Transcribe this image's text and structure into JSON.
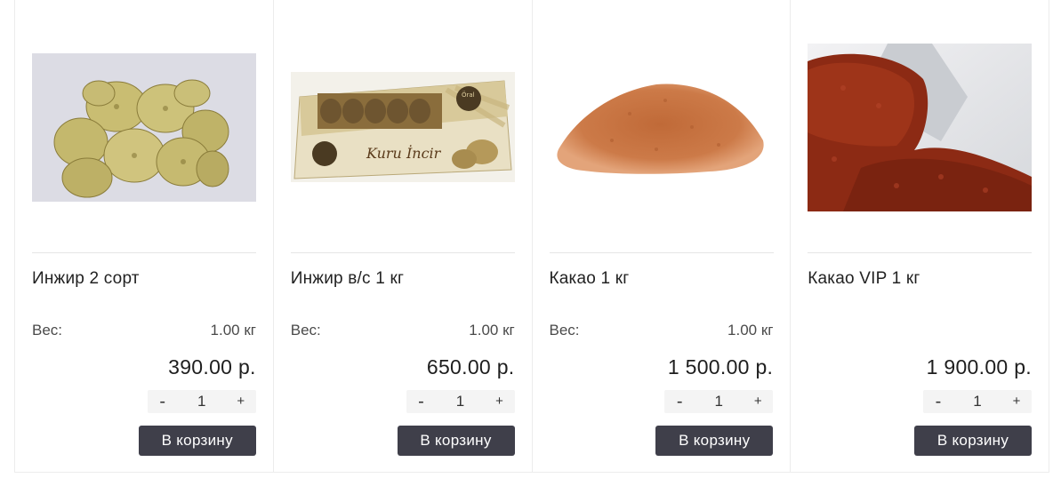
{
  "products": [
    {
      "title": "Инжир 2 сорт",
      "weight_label": "Вес:",
      "weight_value": "1.00 кг",
      "price": "390.00 р.",
      "qty_minus": "-",
      "qty_value": "1",
      "qty_plus": "+",
      "cart_label": "В корзину",
      "image": "dried-figs-photo"
    },
    {
      "title": "Инжир в/с 1 кг",
      "weight_label": "Вес:",
      "weight_value": "1.00 кг",
      "price": "650.00 р.",
      "qty_minus": "-",
      "qty_value": "1",
      "qty_plus": "+",
      "cart_label": "В корзину",
      "image": "boxed-figs-photo",
      "box_text": "Kuru İncir",
      "box_brand": "Öral"
    },
    {
      "title": "Какао 1 кг",
      "weight_label": "Вес:",
      "weight_value": "1.00 кг",
      "price": "1 500.00 р.",
      "qty_minus": "-",
      "qty_value": "1",
      "qty_plus": "+",
      "cart_label": "В корзину",
      "image": "cocoa-powder-photo"
    },
    {
      "title": "Какао VIP 1 кг",
      "price": "1 900.00 р.",
      "qty_minus": "-",
      "qty_value": "1",
      "qty_plus": "+",
      "cart_label": "В корзину",
      "image": "cocoa-scoop-photo"
    }
  ],
  "colors": {
    "button_bg": "#3f3f4a",
    "qty_bg": "#f4f4f4",
    "border": "#ececec"
  }
}
